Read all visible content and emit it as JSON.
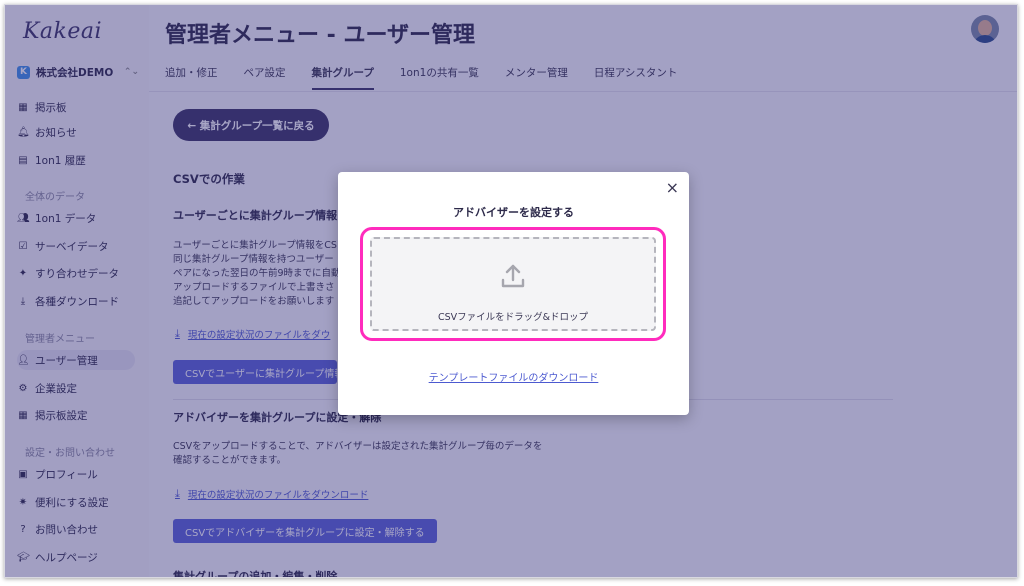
{
  "app": {
    "logo": "Kakeai",
    "company": "株式会社DEMO",
    "company_badge": "K"
  },
  "sidebar": {
    "top_items": [
      {
        "label": "掲示板",
        "icon": "board-icon"
      },
      {
        "label": "お知らせ",
        "icon": "bell-icon"
      },
      {
        "label": "1on1 履歴",
        "icon": "history-icon"
      }
    ],
    "section_all_data": "全体のデータ",
    "data_items": [
      {
        "label": "1on1 データ",
        "icon": "people-icon"
      },
      {
        "label": "サーベイデータ",
        "icon": "calendar-check-icon"
      },
      {
        "label": "すり合わせデータ",
        "icon": "puzzle-icon"
      },
      {
        "label": "各種ダウンロード",
        "icon": "download-icon"
      }
    ],
    "section_admin": "管理者メニュー",
    "admin_items": [
      {
        "label": "ユーザー管理",
        "icon": "user-manage-icon"
      },
      {
        "label": "企業設定",
        "icon": "company-icon"
      },
      {
        "label": "掲示板設定",
        "icon": "board-settings-icon"
      }
    ],
    "section_settings": "設定・お問い合わせ",
    "settings_items": [
      {
        "label": "プロフィール",
        "icon": "profile-icon"
      },
      {
        "label": "便利にする設定",
        "icon": "gear-icon"
      },
      {
        "label": "お問い合わせ",
        "icon": "help-icon"
      },
      {
        "label": "ヘルプページ",
        "icon": "graduation-icon"
      }
    ]
  },
  "header": {
    "title": "管理者メニュー - ユーザー管理"
  },
  "tabs": [
    {
      "label": "追加・修正"
    },
    {
      "label": "ペア設定"
    },
    {
      "label": "集計グループ"
    },
    {
      "label": "1on1の共有一覧"
    },
    {
      "label": "メンター管理"
    },
    {
      "label": "日程アシスタント"
    }
  ],
  "main": {
    "back_button": "← 集計グループ一覧に戻る",
    "csv_heading": "CSVでの作業",
    "section1_heading": "ユーザーごとに集計グループ情報",
    "section1_lines": [
      "ユーザーごとに集計グループ情報をCS",
      "同じ集計グループ情報を持つユーザー",
      "ペアになった翌日の午前9時までに自動",
      "アップロードするファイルで上書きさ",
      "追記してアップロードをお願いします"
    ],
    "section1_link": "現在の設定状況のファイルをダウ",
    "section1_button": "CSVでユーザーに集計グループ情報",
    "section2_heading": "アドバイザーを集計グループに設定・解除",
    "section2_lines": [
      "CSVをアップロードすることで、アドバイザーは設定された集計グループ毎のデータを",
      "確認することができます。"
    ],
    "section2_link": "現在の設定状況のファイルをダウンロード",
    "section2_button": "CSVでアドバイザーを集計グループに設定・解除する",
    "section3_heading": "集計グループの追加・編集・削除"
  },
  "modal": {
    "title": "アドバイザーを設定する",
    "close": "×",
    "drop_text": "CSVファイルをドラッグ&ドロップ",
    "template_link": "テンプレートファイルのダウンロード"
  },
  "colors": {
    "brand": "#3b3566",
    "primary_button": "#5b63d8",
    "highlight": "#ff2bbd",
    "link": "#4c5ad0"
  }
}
